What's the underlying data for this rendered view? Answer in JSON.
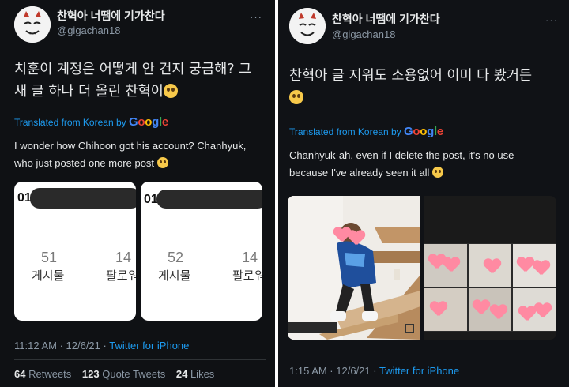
{
  "left_tweet": {
    "author_name": "찬혁아 너땜에 기가찬다",
    "author_handle": "@gigachan18",
    "more_icon": "more-dots-icon",
    "text_line1": "치훈이 계정은 어떻게 안 건지 궁금해? 그",
    "text_line2": "새 글 하나 더 올린 찬혁이",
    "translated_prefix": "Translated from Korean by",
    "google_letters": [
      "G",
      "o",
      "o",
      "g",
      "l",
      "e"
    ],
    "translation_line1": "I wonder how Chihoon got his account? Chanhyuk,",
    "translation_line2": "who just posted one more post",
    "cards": [
      {
        "id_prefix": "01",
        "posts": "51",
        "posts_label": "게시물",
        "followers": "14",
        "followers_label": "팔로워"
      },
      {
        "id_prefix": "01",
        "posts": "52",
        "posts_label": "게시물",
        "followers": "14",
        "followers_label": "팔로워"
      }
    ],
    "timestamp": "11:12 AM · 12/6/21 ·",
    "source": "Twitter for iPhone",
    "retweets_count": "64",
    "retweets_label": "Retweets",
    "quotes_count": "123",
    "quotes_label": "Quote Tweets",
    "likes_count": "24",
    "likes_label": "Likes"
  },
  "right_tweet": {
    "author_name": "찬혁아 너땜에 기가찬다",
    "author_handle": "@gigachan18",
    "more_icon": "more-dots-icon",
    "text_line1": "찬혁아 글 지워도 소용없어 이미 다 봤거든",
    "translated_prefix": "Translated from Korean by",
    "google_letters": [
      "G",
      "o",
      "o",
      "g",
      "l",
      "e"
    ],
    "translation_line1": "Chanhyuk-ah, even if I delete the post, it's no use",
    "translation_line2": "because I've already seen it all",
    "timestamp": "1:15 AM · 12/6/21 ·",
    "source": "Twitter for iPhone"
  },
  "colors": {
    "background": "#0f1114",
    "link": "#1d9bf0",
    "muted": "#8b98a5",
    "heart_sticker": "#ff8aa2"
  }
}
